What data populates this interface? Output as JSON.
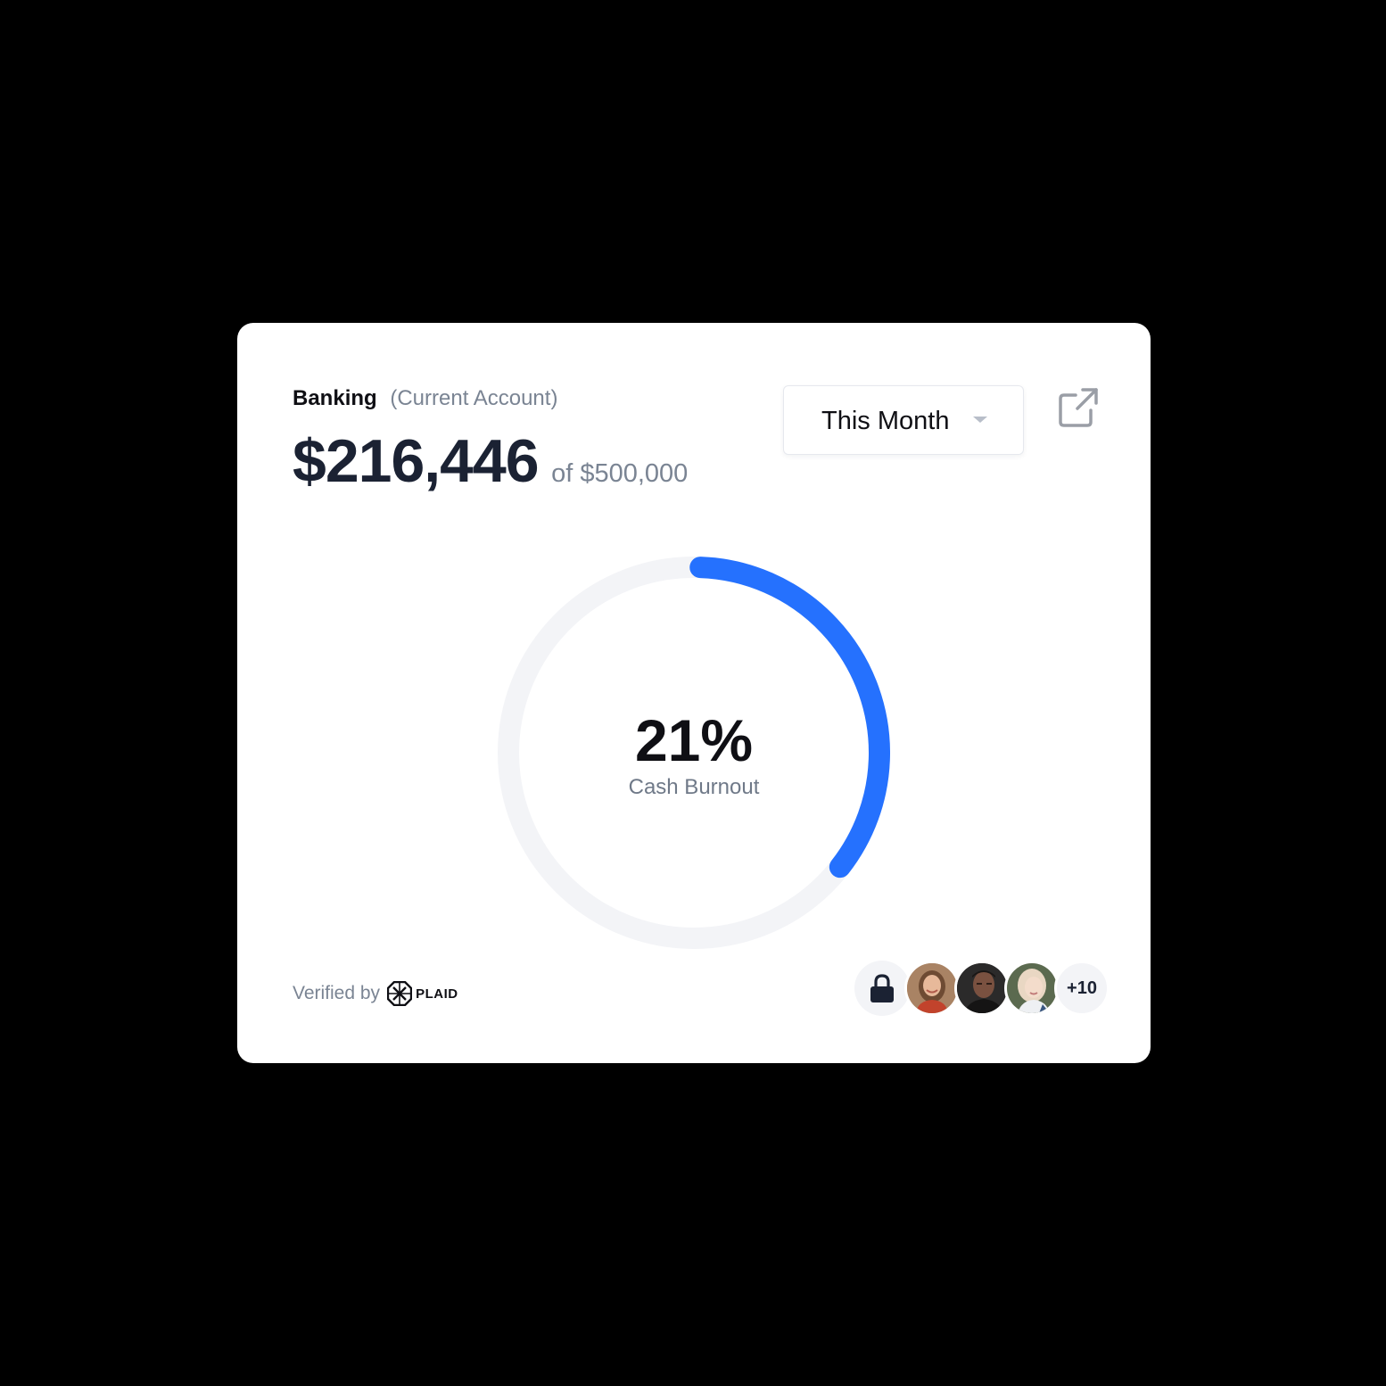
{
  "card": {
    "title": "Banking",
    "subtitle": "(Current Account)",
    "amount": "$216,446",
    "of_total": "of $500,000"
  },
  "period_select": {
    "value": "This Month"
  },
  "gauge": {
    "value_text": "21%",
    "label": "Cash Burnout",
    "fraction": 0.35,
    "track_color": "#f3f4f7",
    "progress_color": "#2571fe"
  },
  "footer": {
    "verified_text": "Verified by",
    "provider_name": "PLAID"
  },
  "members": {
    "more_count": "+10"
  },
  "icons": [
    "external-link-icon",
    "chevron-down-icon",
    "plaid-logo-icon",
    "lock-icon"
  ]
}
